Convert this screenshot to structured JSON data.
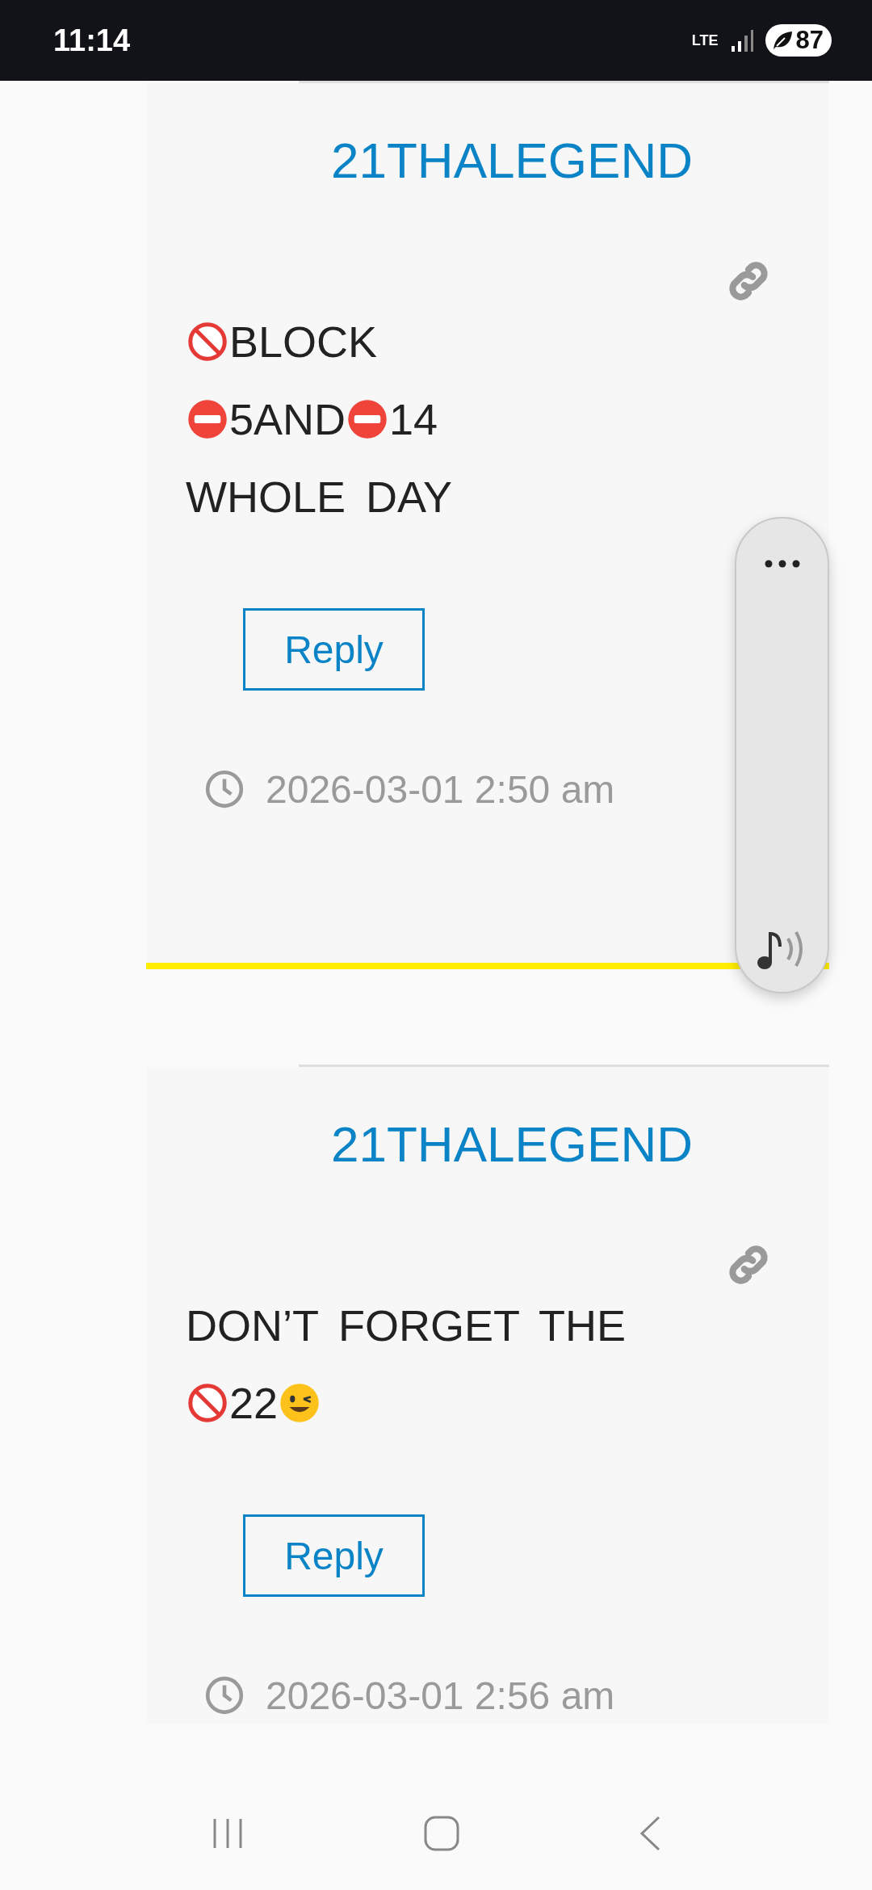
{
  "status_bar": {
    "time": "11:14",
    "network": "LTE",
    "battery": "87"
  },
  "comments": [
    {
      "author": "21THALEGEND",
      "body": [
        [
          {
            "kind": "prohibited"
          },
          {
            "kind": "text",
            "text": "BLOCK"
          }
        ],
        [
          {
            "kind": "no-entry"
          },
          {
            "kind": "text",
            "text": "5AND"
          },
          {
            "kind": "no-entry"
          },
          {
            "kind": "text",
            "text": "14"
          }
        ],
        [
          {
            "kind": "text",
            "text": "WHOLE DAY"
          }
        ]
      ],
      "reply": "Reply",
      "timestamp": "2026-03-01 2:50 am",
      "highlighted": true
    },
    {
      "author": "21THALEGEND",
      "body": [
        [
          {
            "kind": "text",
            "text": "DON’T FORGET THE"
          }
        ],
        [
          {
            "kind": "prohibited"
          },
          {
            "kind": "text",
            "text": "22"
          },
          {
            "kind": "wink"
          }
        ]
      ],
      "reply": "Reply",
      "timestamp": "2026-03-01 2:56 am",
      "highlighted": false
    }
  ]
}
